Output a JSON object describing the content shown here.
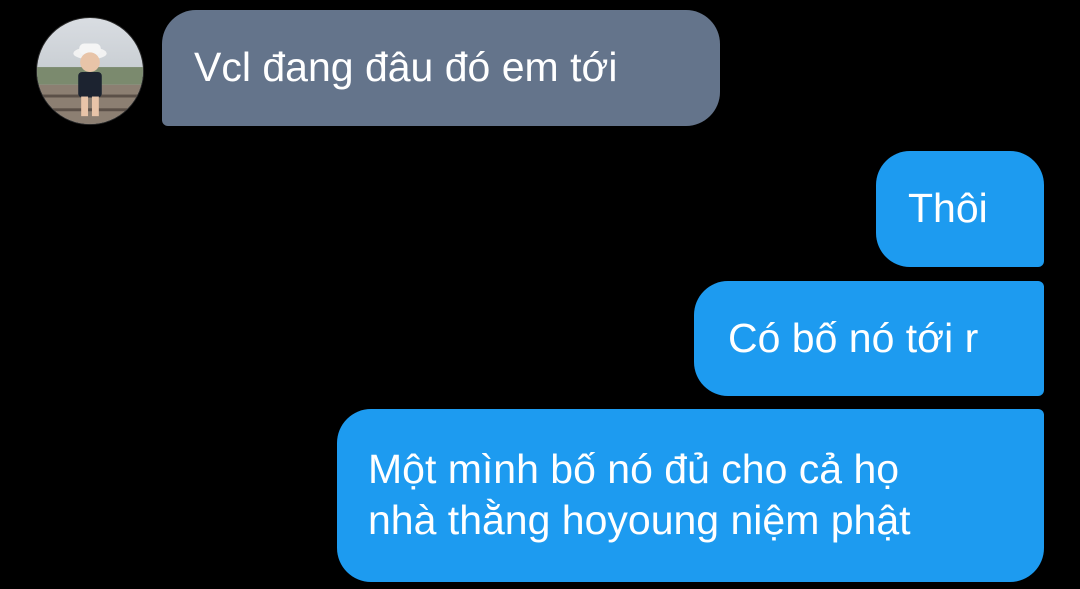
{
  "conversation": {
    "incoming": [
      {
        "text": "Vcl đang đâu đó em tới"
      }
    ],
    "outgoing": [
      {
        "text": "Thôi"
      },
      {
        "text": "Có bố nó tới r"
      },
      {
        "lines": [
          "Một mình bố nó đủ cho cả họ",
          "nhà thằng hoyoung niệm phật"
        ]
      }
    ]
  },
  "colors": {
    "background": "#000000",
    "incoming_bubble": "#64748b",
    "outgoing_bubble": "#1d9bf0",
    "text": "#ffffff"
  },
  "icons": {
    "avatar": "contact-avatar-photo"
  }
}
